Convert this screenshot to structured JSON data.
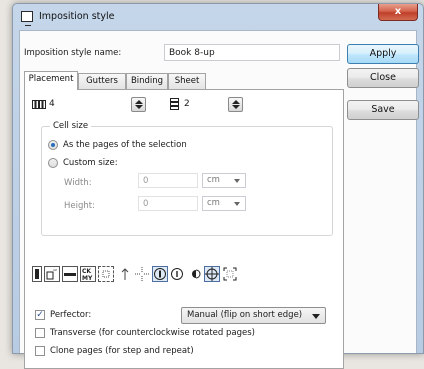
{
  "window": {
    "title": "Imposition style",
    "close_glyph": "x"
  },
  "form": {
    "name_label": "Imposition style name:",
    "name_value": "Book 8-up"
  },
  "buttons": {
    "apply": "Apply",
    "close": "Close",
    "save": "Save"
  },
  "tabs": [
    "Placement",
    "Gutters",
    "Binding",
    "Sheet"
  ],
  "active_tab": "Placement",
  "placement": {
    "columns_icon": "columns-icon",
    "columns_value": "4",
    "rows_icon": "rows-icon",
    "rows_value": "2"
  },
  "cell_size": {
    "title": "Cell size",
    "option_pages": "As the pages of the selection",
    "option_custom": "Custom size:",
    "selected": "As the pages of the selection",
    "width_label": "Width:",
    "width_value": "0",
    "width_unit": "cm",
    "height_label": "Height:",
    "height_value": "0",
    "height_unit": "cm"
  },
  "toolbar_icons": [
    "page-orientation-icon",
    "flip-page-icon",
    "rotate-page-icon",
    "mirror-text-icon",
    "dashed-frame-icon",
    "gutter-arrow-icon",
    "crop-marks-icon",
    "center-circle-icon",
    "circle-i-icon",
    "half-circle-icon",
    "target-icon",
    "frame-corners-icon"
  ],
  "options": {
    "perfector_label": "Perfector:",
    "perfector_checked": true,
    "perfector_mode": "Manual (flip on short edge)",
    "transverse_label": "Transverse (for counterclockwise rotated pages)",
    "transverse_checked": false,
    "clone_label": "Clone pages (for step and repeat)",
    "clone_checked": false
  },
  "colors": {
    "title_gradient": "#c5d6ea",
    "close_red": "#c0402a",
    "primary_border": "#3c7fb1"
  }
}
